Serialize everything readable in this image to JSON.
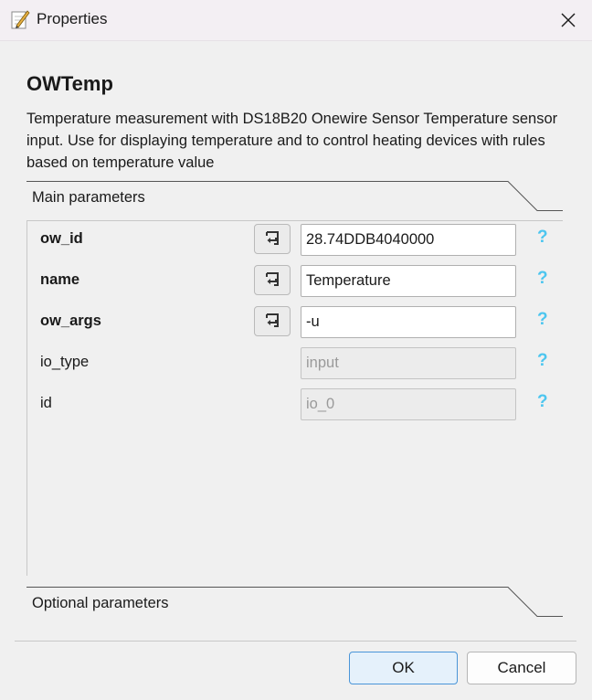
{
  "window": {
    "title": "Properties",
    "title_icon": "edit-note-icon",
    "close_icon": "close-icon"
  },
  "component": {
    "name": "OWTemp",
    "description": "Temperature measurement with DS18B20 Onewire Sensor Temperature sensor input. Use for displaying temperature and to control heating devices with rules based on temperature value"
  },
  "sections": {
    "main": "Main parameters",
    "optional": "Optional parameters"
  },
  "params": [
    {
      "label": "ow_id",
      "value": "28.74DDB4040000",
      "bold": true,
      "has_reset": true,
      "editable": true,
      "help": "?"
    },
    {
      "label": "name",
      "value": "Temperature",
      "bold": true,
      "has_reset": true,
      "editable": true,
      "help": "?"
    },
    {
      "label": "ow_args",
      "value": "-u",
      "bold": true,
      "has_reset": true,
      "editable": true,
      "help": "?"
    },
    {
      "label": "io_type",
      "value": "input",
      "bold": false,
      "has_reset": false,
      "editable": false,
      "help": "?"
    },
    {
      "label": "id",
      "value": "io_0",
      "bold": false,
      "has_reset": false,
      "editable": false,
      "help": "?"
    }
  ],
  "buttons": {
    "ok": "OK",
    "cancel": "Cancel"
  },
  "colors": {
    "help_accent": "#4dc6ef",
    "ok_border": "#4a95d8",
    "ok_background": "#e5f1fb"
  }
}
